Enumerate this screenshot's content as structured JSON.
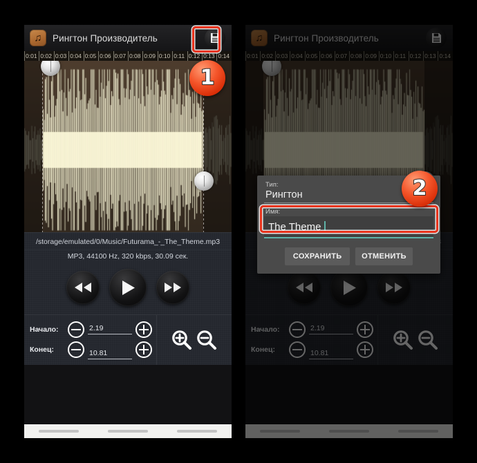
{
  "app": {
    "title": "Рингтон Производитель",
    "icon": "music-note-app-icon",
    "save_icon": "floppy-disk-save-icon"
  },
  "ruler": {
    "ticks": [
      "0:01",
      "0:02",
      "0:03",
      "0:04",
      "0:05",
      "0:06",
      "0:07",
      "0:08",
      "0:09",
      "0:10",
      "0:11",
      "0:12",
      "0:13",
      "0:14"
    ]
  },
  "file": {
    "path": "/storage/emulated/0/Music/Futurama_-_The_Theme.mp3",
    "info": "MP3, 44100 Hz, 320 kbps, 30.09 сек."
  },
  "transport": {
    "rewind": "rewind-button",
    "play": "play-button",
    "forward": "fast-forward-button"
  },
  "markers": {
    "start_label": "Начало:",
    "end_label": "Конец:",
    "start_value": "2.19",
    "end_value": "10.81"
  },
  "zoom_controls": {
    "zoom_in": "zoom-in-icon",
    "zoom_out": "zoom-out-icon"
  },
  "dialog": {
    "type_label": "Тип:",
    "type_value": "Рингтон",
    "name_label": "Имя:",
    "name_value": "The Theme",
    "save_button": "СОХРАНИТЬ",
    "cancel_button": "ОТМЕНИТЬ"
  },
  "annotations": {
    "step1": "1",
    "step2": "2",
    "highlight_color": "#e8331c"
  }
}
